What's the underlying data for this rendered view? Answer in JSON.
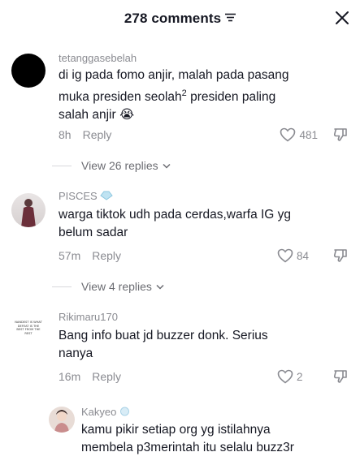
{
  "header": {
    "title": "278 comments"
  },
  "comments": [
    {
      "username": "tetanggasebelah",
      "text_lines": [
        "di ig pada fomo anjir, malah pada pasang",
        "muka presiden seolah",
        " presiden paling",
        "salah anjir"
      ],
      "superscript": "2",
      "emoji": "😭",
      "time": "8h",
      "reply_label": "Reply",
      "likes": "481",
      "view_replies": "View 26 replies"
    },
    {
      "username": "PISCES",
      "text_lines": [
        "warga tiktok udh pada cerdas,warfa IG yg",
        "belum sadar"
      ],
      "time": "57m",
      "reply_label": "Reply",
      "likes": "84",
      "view_replies": "View 4 replies"
    },
    {
      "username": "Rikimaru170",
      "avatar_text": "NANDEST IS WHAT\nDEFEAT IS THE\nBEST FROM THE\nREST",
      "text_lines": [
        "Bang info buat jd buzzer donk. Serius",
        "nanya"
      ],
      "time": "16m",
      "reply_label": "Reply",
      "likes": "2"
    },
    {
      "username": "Kakyeo",
      "text_lines": [
        "kamu pikir setiap org yg istilahnya",
        "membela p3merintah itu selalu buzz3r"
      ]
    }
  ]
}
